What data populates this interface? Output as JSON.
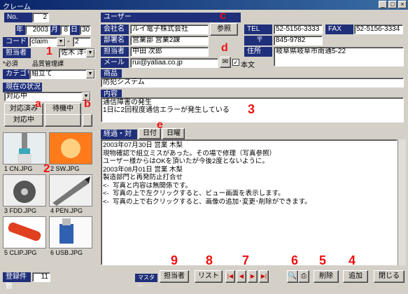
{
  "window": {
    "title": "クレーム"
  },
  "record": {
    "no_label": "No.",
    "no_value": "2",
    "date_label": "年",
    "date_year": "2003",
    "date_month_label": "月",
    "date_month": "8",
    "date_day_label": "日",
    "date_day": "30",
    "code_label": "コード",
    "code_value": "claim",
    "code_sep": "-",
    "code_num": "2",
    "tanto_label": "担当者",
    "tanto_value": "佐木 洋子",
    "required_note": "*必須",
    "dept_value": "品質管理課",
    "category_label": "カテゴリ",
    "category_value": "組立て",
    "status_label": "現在の状況",
    "status_value": "対応中",
    "status_buttons": [
      "対応済み",
      "待機中",
      "対応中"
    ]
  },
  "user": {
    "section_label": "ユーザー",
    "company_label": "会社名",
    "company_value": "ルイ電子株式会社",
    "ref_button": "参照",
    "dept_label": "部署名",
    "dept_value": "営業部 営業2課",
    "person_label": "担当者",
    "person_value": "中田 次郎",
    "mail_label": "メール",
    "mail_value": "rui@yatiaa.co.jp",
    "honbun_label": "本文",
    "tel_label": "TEL",
    "tel_value": "52-5156-3333",
    "fax_label": "FAX",
    "fax_value": "52-5156-3334",
    "zip_label": "〒",
    "zip_value": "845-9782",
    "addr_label": "住所",
    "addr_value": "岐阜県岐阜市南通5-22"
  },
  "product": {
    "label": "商品",
    "value": "防犯システム"
  },
  "content": {
    "label": "内容",
    "lines": [
      "通信障害の発生",
      "1日に2回程度通信エラーが発生している"
    ]
  },
  "progress": {
    "label": "経過・対策",
    "tab_date": "日付",
    "tab_weekday": "日曜",
    "lines": [
      "2003年07月30日 営業 木梨",
      "現物確認で組立ミスがあった。その場で修理（写真参照）",
      "ユーザー様からはOKを頂いたが今後2度とないように。",
      "",
      "",
      "2003年08月01日 営業 木梨",
      "製造部門と再発防止打合せ",
      "",
      "<-  写真と内容は無関係です。",
      "",
      "<-  写真の上で左クリックすると、ビュー画面を表示します。",
      "",
      "<-  写真の上で右クリックすると、画像の追加･変更･削除ができます。"
    ]
  },
  "photos": [
    {
      "caption": "1 CN.JPG",
      "icon": "cable-photo",
      "color": "#3aa8b8"
    },
    {
      "caption": "2 SW.JPG",
      "icon": "light-photo",
      "color": "#ff7a1a"
    },
    {
      "caption": "3 FDD.JPG",
      "icon": "disk-photo",
      "color": "#555555"
    },
    {
      "caption": "4 PEN.JPG",
      "icon": "pen-photo",
      "color": "#777777"
    },
    {
      "caption": "5 CLIP.JPG",
      "icon": "clip-photo",
      "color": "#e04020"
    },
    {
      "caption": "6 USB.JPG",
      "icon": "usb-photo",
      "color": "#3060b0"
    }
  ],
  "footer": {
    "count_label": "登録件数",
    "count_value": "11",
    "master_label": "マスター",
    "tanto_btn": "担当者",
    "list_btn": "リスト",
    "delete_btn": "削除",
    "add_btn": "追加",
    "close_btn": "閉じる"
  },
  "annotations": [
    "1",
    "2",
    "3",
    "4",
    "5",
    "6",
    "7",
    "8",
    "9",
    "a",
    "b",
    "c",
    "d",
    "e"
  ]
}
